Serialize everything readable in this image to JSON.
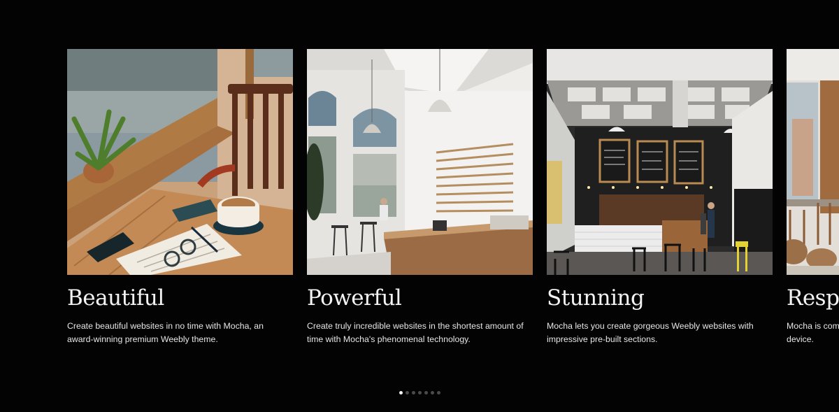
{
  "cards": [
    {
      "title": "Beautiful",
      "description": "Create beautiful websites in no time with Mocha, an award-winning premium Weebly theme.",
      "image": "cafe-window-table-coffee"
    },
    {
      "title": "Powerful",
      "description": "Create truly incredible websites in the shortest amount of time with Mocha's phenomenal technology.",
      "image": "bright-cafe-counter-menu-board"
    },
    {
      "title": "Stunning",
      "description": "Mocha lets you create gorgeous Weebly websites with impressive pre-built sections.",
      "image": "dark-coffee-shop-interior"
    },
    {
      "title": "Responsive",
      "description": "Mocha is completely responsive and adapts to every device.",
      "image": "restaurant-terrace-chairs"
    }
  ],
  "menu_board": [
    "FILTER COFFEE",
    "ESPRESSO",
    "SINGLE ORIGIN COFFEE",
    "MACCHIATO",
    "CHOCOLATE",
    "CAPPUCCINO",
    "LATTE",
    "MOCHA",
    "CHAI",
    "TEA"
  ],
  "pagination": {
    "count": 7,
    "active_index": 0
  },
  "colors": {
    "background": "#030303",
    "text": "#f3f3f3",
    "dot_active": "#f2f2f2",
    "dot_inactive": "#4a4a4a"
  }
}
